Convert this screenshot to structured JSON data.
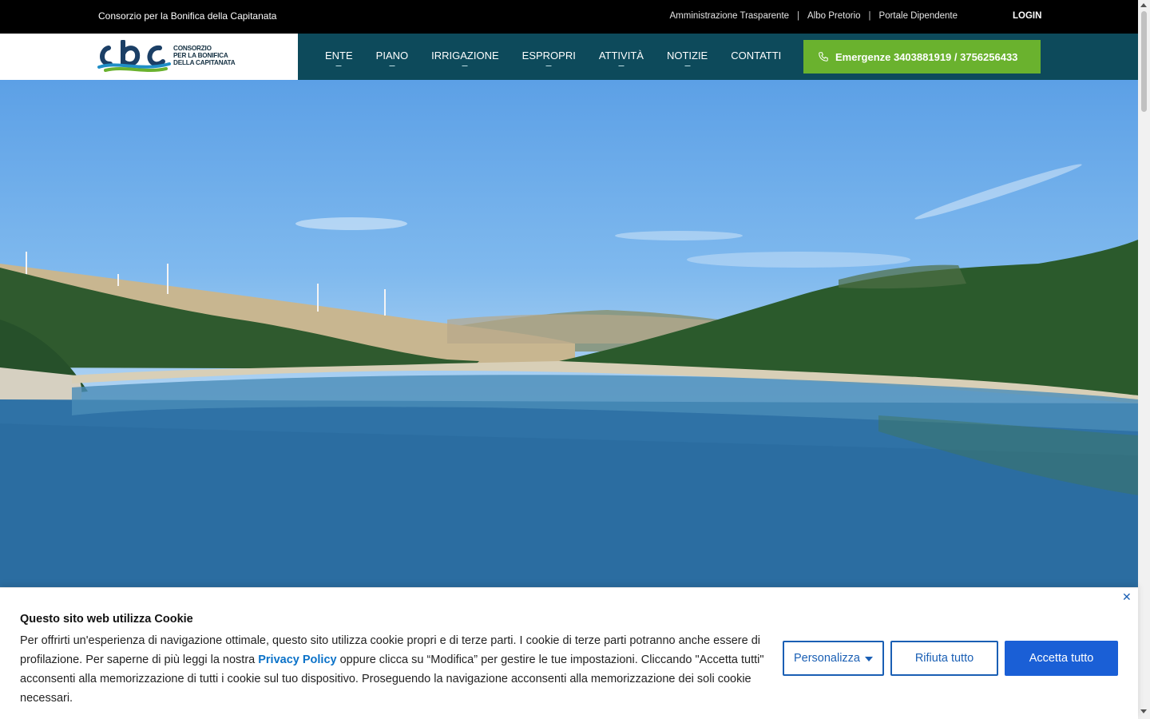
{
  "topbar": {
    "site_name": "Consorzio per la Bonifica della Capitanata",
    "links": [
      "Amministrazione Trasparente",
      "Albo Pretorio",
      "Portale Dipendente"
    ],
    "separator": "|",
    "login": "LOGIN"
  },
  "header": {
    "logo_lines": [
      "CONSORZIO",
      "PER LA BONIFICA",
      "DELLA CAPITANATA"
    ],
    "nav": [
      "ENTE",
      "PIANO",
      "IRRIGAZIONE",
      "ESPROPRI",
      "ATTIVITÀ",
      "NOTIZIE",
      "CONTATTI"
    ],
    "emergency": "Emergenze 3403881919 / 3756256433",
    "emergency_icon": "phone-icon"
  },
  "cookie": {
    "title": "Questo sito web utilizza Cookie",
    "text_before": "Per offrirti un'esperienza di navigazione ottimale, questo sito utilizza cookie propri e di terze parti. I cookie di terze parti potranno anche essere di profilazione. Per saperne di più leggi la nostra ",
    "privacy_link": "Privacy Policy",
    "text_after": " oppure clicca su “Modifica” per gestire le tue impostazioni. Cliccando \"Accetta tutti\" acconsenti alla memorizzazione di tutti i cookie sul tuo dispositivo. Proseguendo la navigazione acconsenti alla memorizzazione dei soli cookie necessari.",
    "btn_personalizza": "Personalizza",
    "btn_rifiuta": "Rifiuta tutto",
    "btn_accetta": "Accetta tutto",
    "close_glyph": "✕"
  },
  "colors": {
    "header_bg": "#0d4a5b",
    "emergency_bg": "#6ab22e",
    "button_blue": "#1a5fd6"
  }
}
